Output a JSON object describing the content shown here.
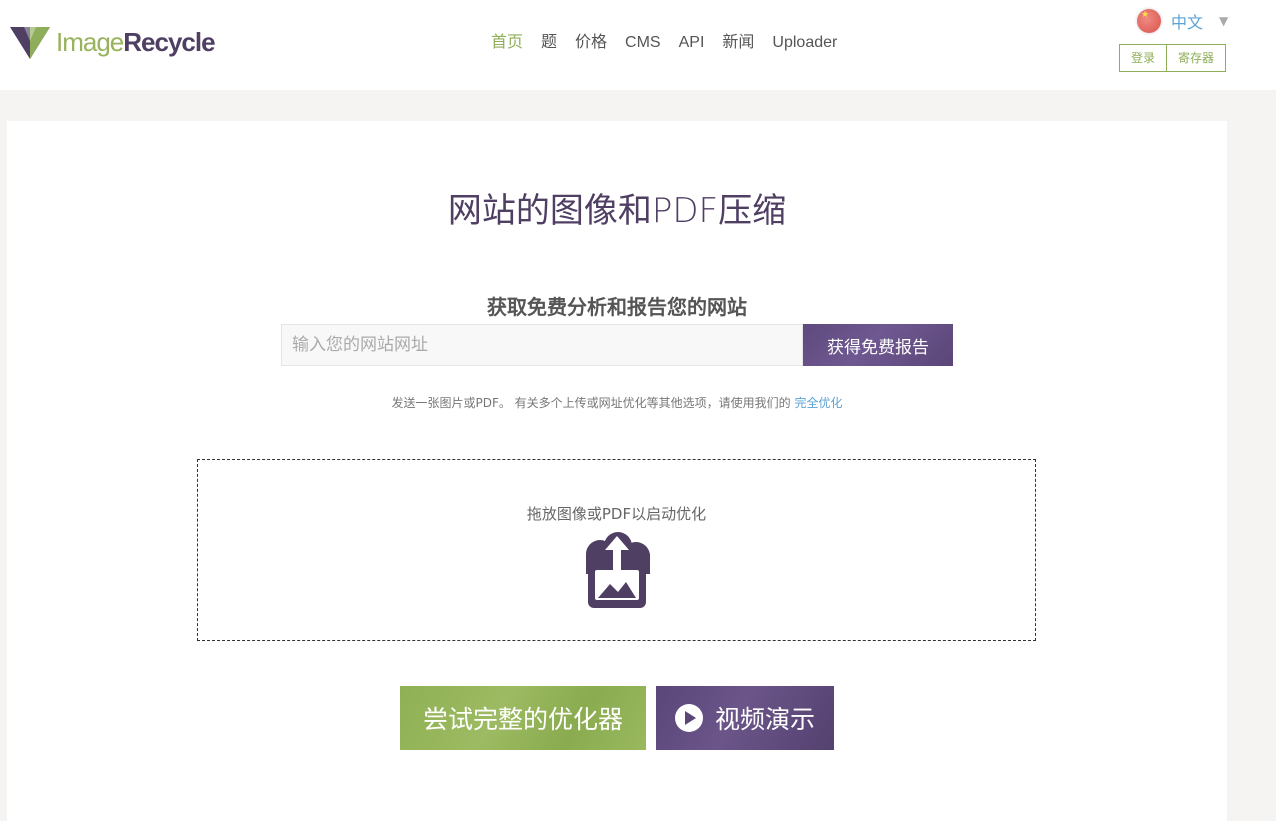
{
  "brand": {
    "name_part1": "Image",
    "name_part2": "Recycle"
  },
  "nav": {
    "items": [
      {
        "label": "首页",
        "active": true
      },
      {
        "label": "题"
      },
      {
        "label": "价格"
      },
      {
        "label": "CMS"
      },
      {
        "label": "API"
      },
      {
        "label": "新闻"
      },
      {
        "label": "Uploader"
      }
    ]
  },
  "language": {
    "label": "中文",
    "arrow": "▼"
  },
  "auth": {
    "login": "登录",
    "register": "寄存器"
  },
  "main": {
    "headline": "网站的图像和PDF压缩",
    "subheadline": "获取免费分析和报告您的网站",
    "search": {
      "placeholder": "输入您的网站网址",
      "value": ""
    },
    "report_button": "获得免费报告",
    "note_text": "发送一张图片或PDF。 有关多个上传或网址优化等其他选项，请使用我们的",
    "note_link": "完全优化",
    "dropzone_text": "拖放图像或PDF以启动优化",
    "cta_optimizer": "尝试完整的优化器",
    "cta_video": "视频演示"
  },
  "colors": {
    "brand_green": "#8fae5a",
    "brand_purple": "#4f3f63",
    "link_blue": "#5aa3d4"
  }
}
